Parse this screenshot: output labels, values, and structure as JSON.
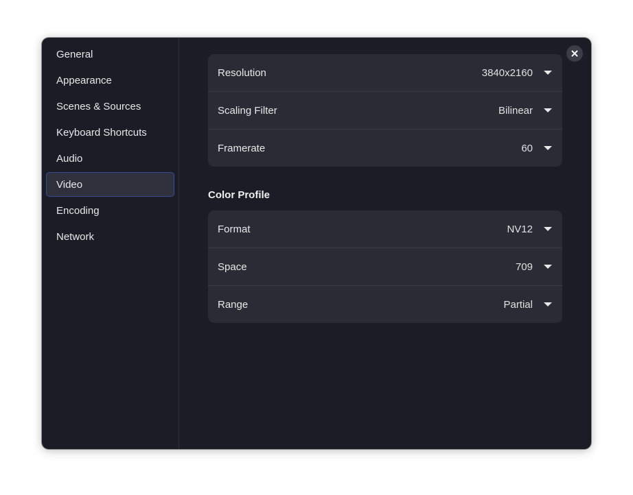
{
  "sidebar": {
    "items": [
      {
        "label": "General"
      },
      {
        "label": "Appearance"
      },
      {
        "label": "Scenes & Sources"
      },
      {
        "label": "Keyboard Shortcuts"
      },
      {
        "label": "Audio"
      },
      {
        "label": "Video",
        "active": true
      },
      {
        "label": "Encoding"
      },
      {
        "label": "Network"
      }
    ]
  },
  "video": {
    "rows": [
      {
        "label": "Resolution",
        "value": "3840x2160"
      },
      {
        "label": "Scaling Filter",
        "value": "Bilinear"
      },
      {
        "label": "Framerate",
        "value": "60"
      }
    ]
  },
  "color_profile": {
    "title": "Color Profile",
    "rows": [
      {
        "label": "Format",
        "value": "NV12"
      },
      {
        "label": "Space",
        "value": "709"
      },
      {
        "label": "Range",
        "value": "Partial"
      }
    ]
  },
  "icons": {
    "close": "close-icon",
    "dropdown": "chevron-down-icon"
  },
  "colors": {
    "window_bg": "#1b1d26",
    "row_bg": "#2a2c35",
    "active_border": "#3d4a9c"
  }
}
